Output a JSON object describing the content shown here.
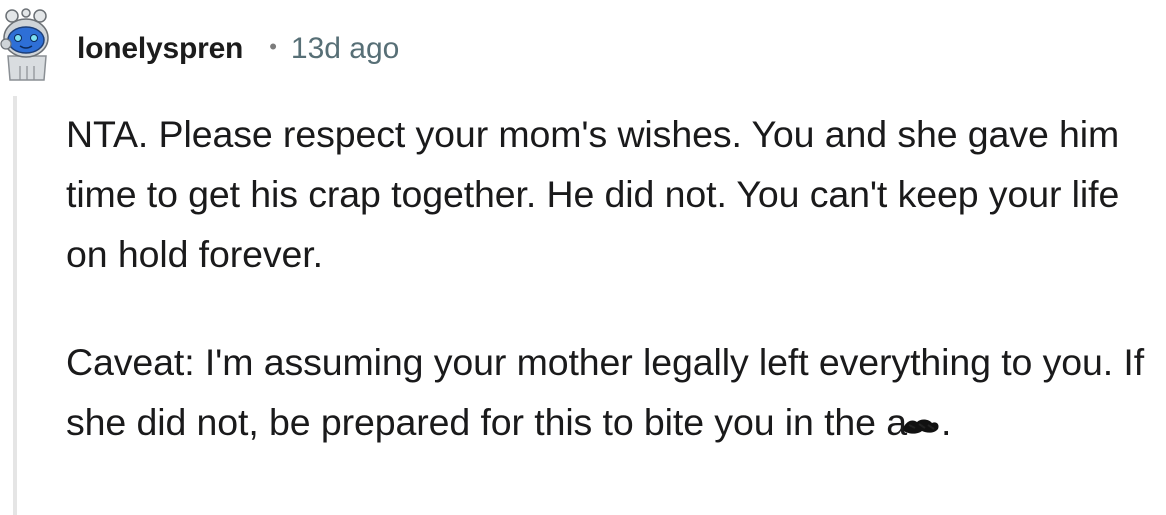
{
  "comment": {
    "author": "lonelyspren",
    "separator": "•",
    "time_ago": "13d ago",
    "paragraphs": [
      "NTA. Please respect your mom's wishes. You and she gave him time to get his crap together. He did not. You can't keep your life on hold forever.",
      "Caveat: I'm assuming your mother legally left everything to you. If she did not, be prepared for this to bite you in"
    ],
    "last_words_before_redaction": "the a",
    "after_redaction": "."
  },
  "colors": {
    "username": "#1c1c1c",
    "timestamp": "#576f76",
    "body_text": "#1a1a1b",
    "thread_line": "#e5e5e5",
    "avatar_blue": "#2e6fd6"
  }
}
